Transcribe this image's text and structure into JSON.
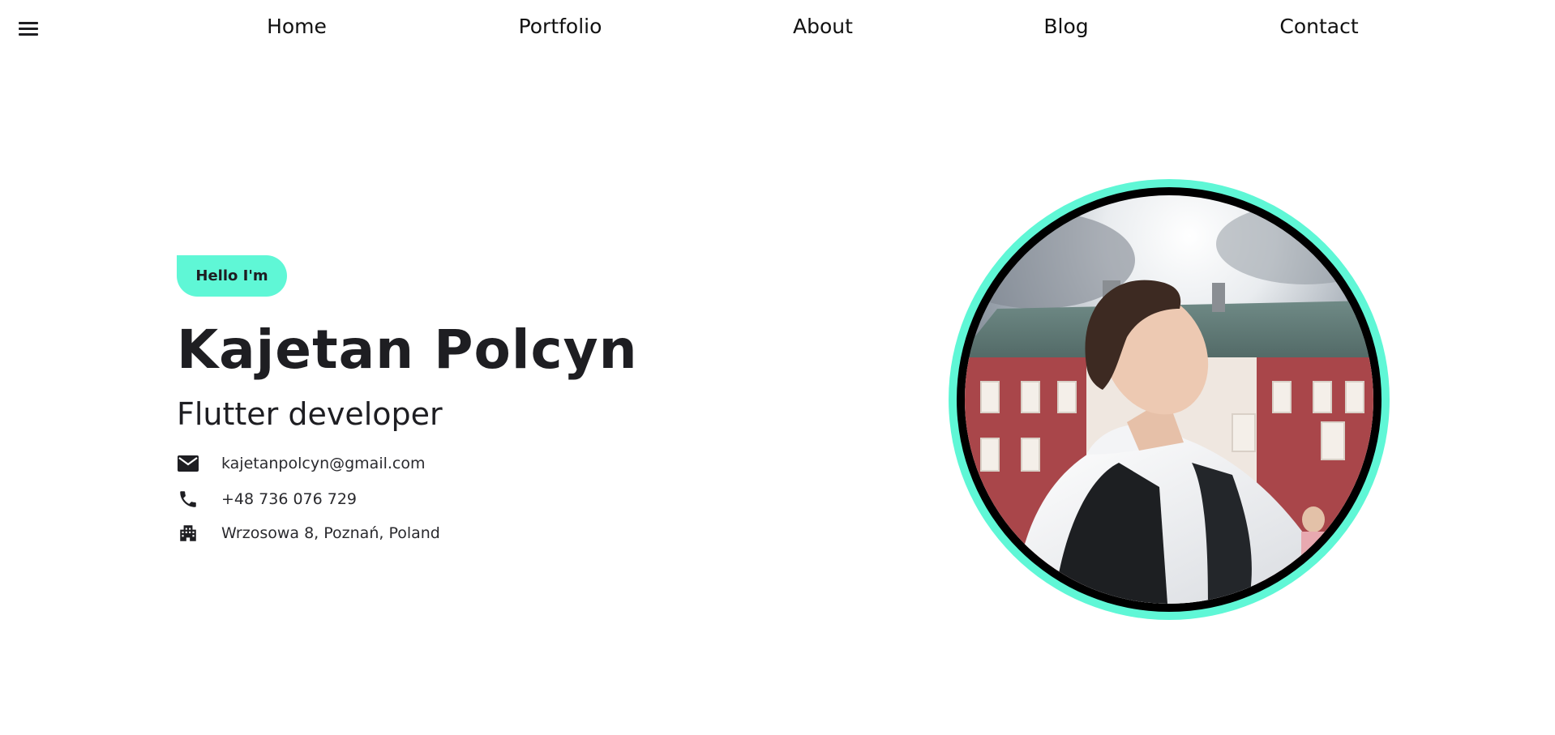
{
  "nav": {
    "menu_icon": "hamburger-menu-icon",
    "links": {
      "home": "Home",
      "portfolio": "Portfolio",
      "about": "About",
      "blog": "Blog",
      "contact": "Contact"
    }
  },
  "hero": {
    "greeting": "Hello I'm",
    "name": "Kajetan Polcyn",
    "role": "Flutter developer",
    "contacts": {
      "email": {
        "icon": "mail-icon",
        "text": "kajetanpolcyn@gmail.com"
      },
      "phone": {
        "icon": "phone-icon",
        "text": "+48 736 076 729"
      },
      "address": {
        "icon": "building-icon",
        "text": "Wrzosowa 8, Poznań, Poland"
      }
    }
  },
  "colors": {
    "accent": "#5ff7d6",
    "text": "#1e1e22",
    "background": "#ffffff"
  }
}
